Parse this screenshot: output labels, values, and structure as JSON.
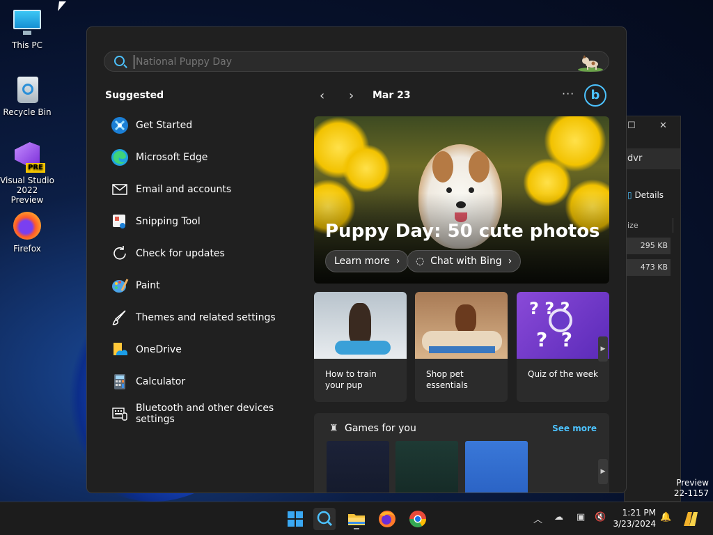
{
  "desktop": {
    "icons": [
      {
        "label": "This PC"
      },
      {
        "label": "Recycle Bin"
      },
      {
        "label": "Visual Studio 2022 Preview"
      },
      {
        "label": "Firefox"
      }
    ],
    "vs_badge": "PRE",
    "build_text_line1": "Preview",
    "build_text_line2": "22-1157"
  },
  "background_window": {
    "address_fragment": "dvr",
    "details_label": "Details",
    "column_header": "ize",
    "rows": [
      "295 KB",
      "473 KB"
    ]
  },
  "search": {
    "placeholder": "National Puppy Day"
  },
  "suggested": {
    "title": "Suggested",
    "items": [
      {
        "label": "Get Started",
        "icon": "get-started-icon"
      },
      {
        "label": "Microsoft Edge",
        "icon": "edge-icon"
      },
      {
        "label": "Email and accounts",
        "icon": "mail-icon"
      },
      {
        "label": "Snipping Tool",
        "icon": "snipping-tool-icon"
      },
      {
        "label": "Check for updates",
        "icon": "refresh-icon"
      },
      {
        "label": "Paint",
        "icon": "paint-icon"
      },
      {
        "label": "Themes and related settings",
        "icon": "brush-icon"
      },
      {
        "label": "OneDrive",
        "icon": "onedrive-icon"
      },
      {
        "label": "Calculator",
        "icon": "calculator-icon"
      },
      {
        "label": "Bluetooth and other devices settings",
        "icon": "devices-icon"
      }
    ]
  },
  "highlights": {
    "date": "Mar 23",
    "more_glyph": "···",
    "bing_glyph": "b",
    "hero_title": "Puppy Day: 50 cute photos",
    "learn_more": "Learn more",
    "chat_with_bing": "Chat with Bing",
    "cards": [
      {
        "caption": "How to train your pup"
      },
      {
        "caption": "Shop pet essentials"
      },
      {
        "caption": "Quiz of the week"
      }
    ]
  },
  "games": {
    "title": "Games for you",
    "see_more": "See more"
  },
  "taskbar": {
    "time": "1:21 PM",
    "date": "3/23/2024"
  },
  "colors": {
    "accent": "#4cc2ff",
    "panel": "#202020",
    "card": "#2b2b2b"
  }
}
